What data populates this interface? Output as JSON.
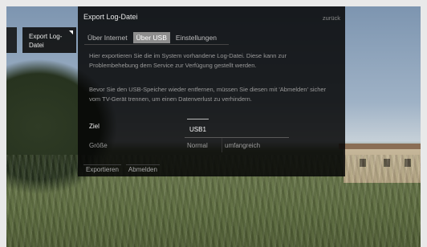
{
  "nav": {
    "back_tile_label": "",
    "item_label": "Export Log-Datei"
  },
  "dialog": {
    "title": "Export Log-Datei",
    "back_label": "zurück",
    "tabs": [
      {
        "label": "Über Internet",
        "active": false
      },
      {
        "label": "Über USB",
        "active": true
      },
      {
        "label": "Einstellungen",
        "active": false
      }
    ],
    "paragraph1": "Hier exportieren Sie die im System vorhandene Log-Datei. Diese kann zur Problembehebung dem Service zur Verfügung gestellt werden.",
    "paragraph2": "Bevor Sie den USB-Speicher wieder entfernen, müssen Sie diesen mit 'Abmelden' sicher vom TV-Gerät trennen, um einen Datenverlust zu verhindern.",
    "fields": {
      "target_label": "Ziel",
      "target_value": "USB1",
      "size_label": "Größe",
      "size_options": [
        "Normal",
        "umfangreich"
      ]
    },
    "actions": [
      "Exportieren",
      "Abmelden"
    ]
  },
  "colors": {
    "dialog_bg": "#060606",
    "active_tab": "#8e8e8e",
    "text_primary": "#ffffff",
    "text_muted": "#9a9a9a"
  }
}
